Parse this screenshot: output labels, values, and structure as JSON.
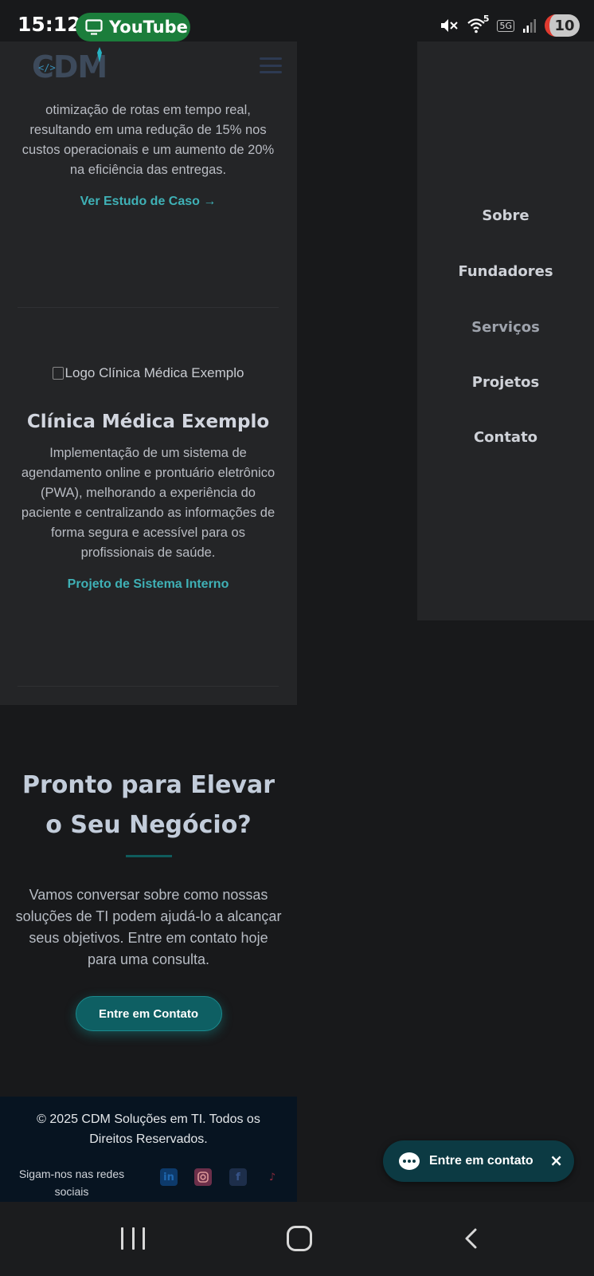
{
  "status_bar": {
    "time": "15:12",
    "app_pill": "YouTube",
    "network": "5G",
    "wifi_badge": "5",
    "battery": "10"
  },
  "site": {
    "logo": "CDM",
    "case_1": {
      "description": "otimização de rotas em tempo real, resultando em uma redução de 15% nos custos operacionais e um aumento de 20% na eficiência das entregas.",
      "link": "Ver Estudo de Caso →"
    },
    "case_2": {
      "logo_alt": "Logo Clínica Médica Exemplo",
      "title": "Clínica Médica Exemplo",
      "description": "Implementação de um sistema de agendamento online e prontuário eletrônico (PWA), melhorando a experiência do paciente e centralizando as informações de forma segura e acessível para os profissionais de saúde.",
      "link": "Projeto de Sistema Interno"
    },
    "cta": {
      "title": "Pronto para Elevar o Seu Negócio?",
      "text": "Vamos conversar sobre como nossas soluções de TI podem ajudá-lo a alcançar seus objetivos. Entre em contato hoje para uma consulta.",
      "button": "Entre em Contato"
    },
    "footer": {
      "copyright": "© 2025 CDM Soluções em TI. Todos os Direitos Reservados.",
      "follow": "Sigam-nos nas redes sociais",
      "social_icons": [
        "linkedin-icon",
        "instagram-icon",
        "facebook-icon",
        "tiktok-icon"
      ]
    }
  },
  "drawer": {
    "items": [
      {
        "label": "Sobre"
      },
      {
        "label": "Fundadores"
      },
      {
        "label": "Serviços"
      },
      {
        "label": "Projetos"
      },
      {
        "label": "Contato"
      }
    ]
  },
  "chat": {
    "label": "Entre em contato",
    "close": "×"
  },
  "colors": {
    "page_bg": "#18191b",
    "panel_bg": "#242527",
    "accent": "#3fb1b6",
    "button_bg": "#0e5f63",
    "footer_bg": "#071421",
    "chat_bg": "#0c3a43"
  }
}
